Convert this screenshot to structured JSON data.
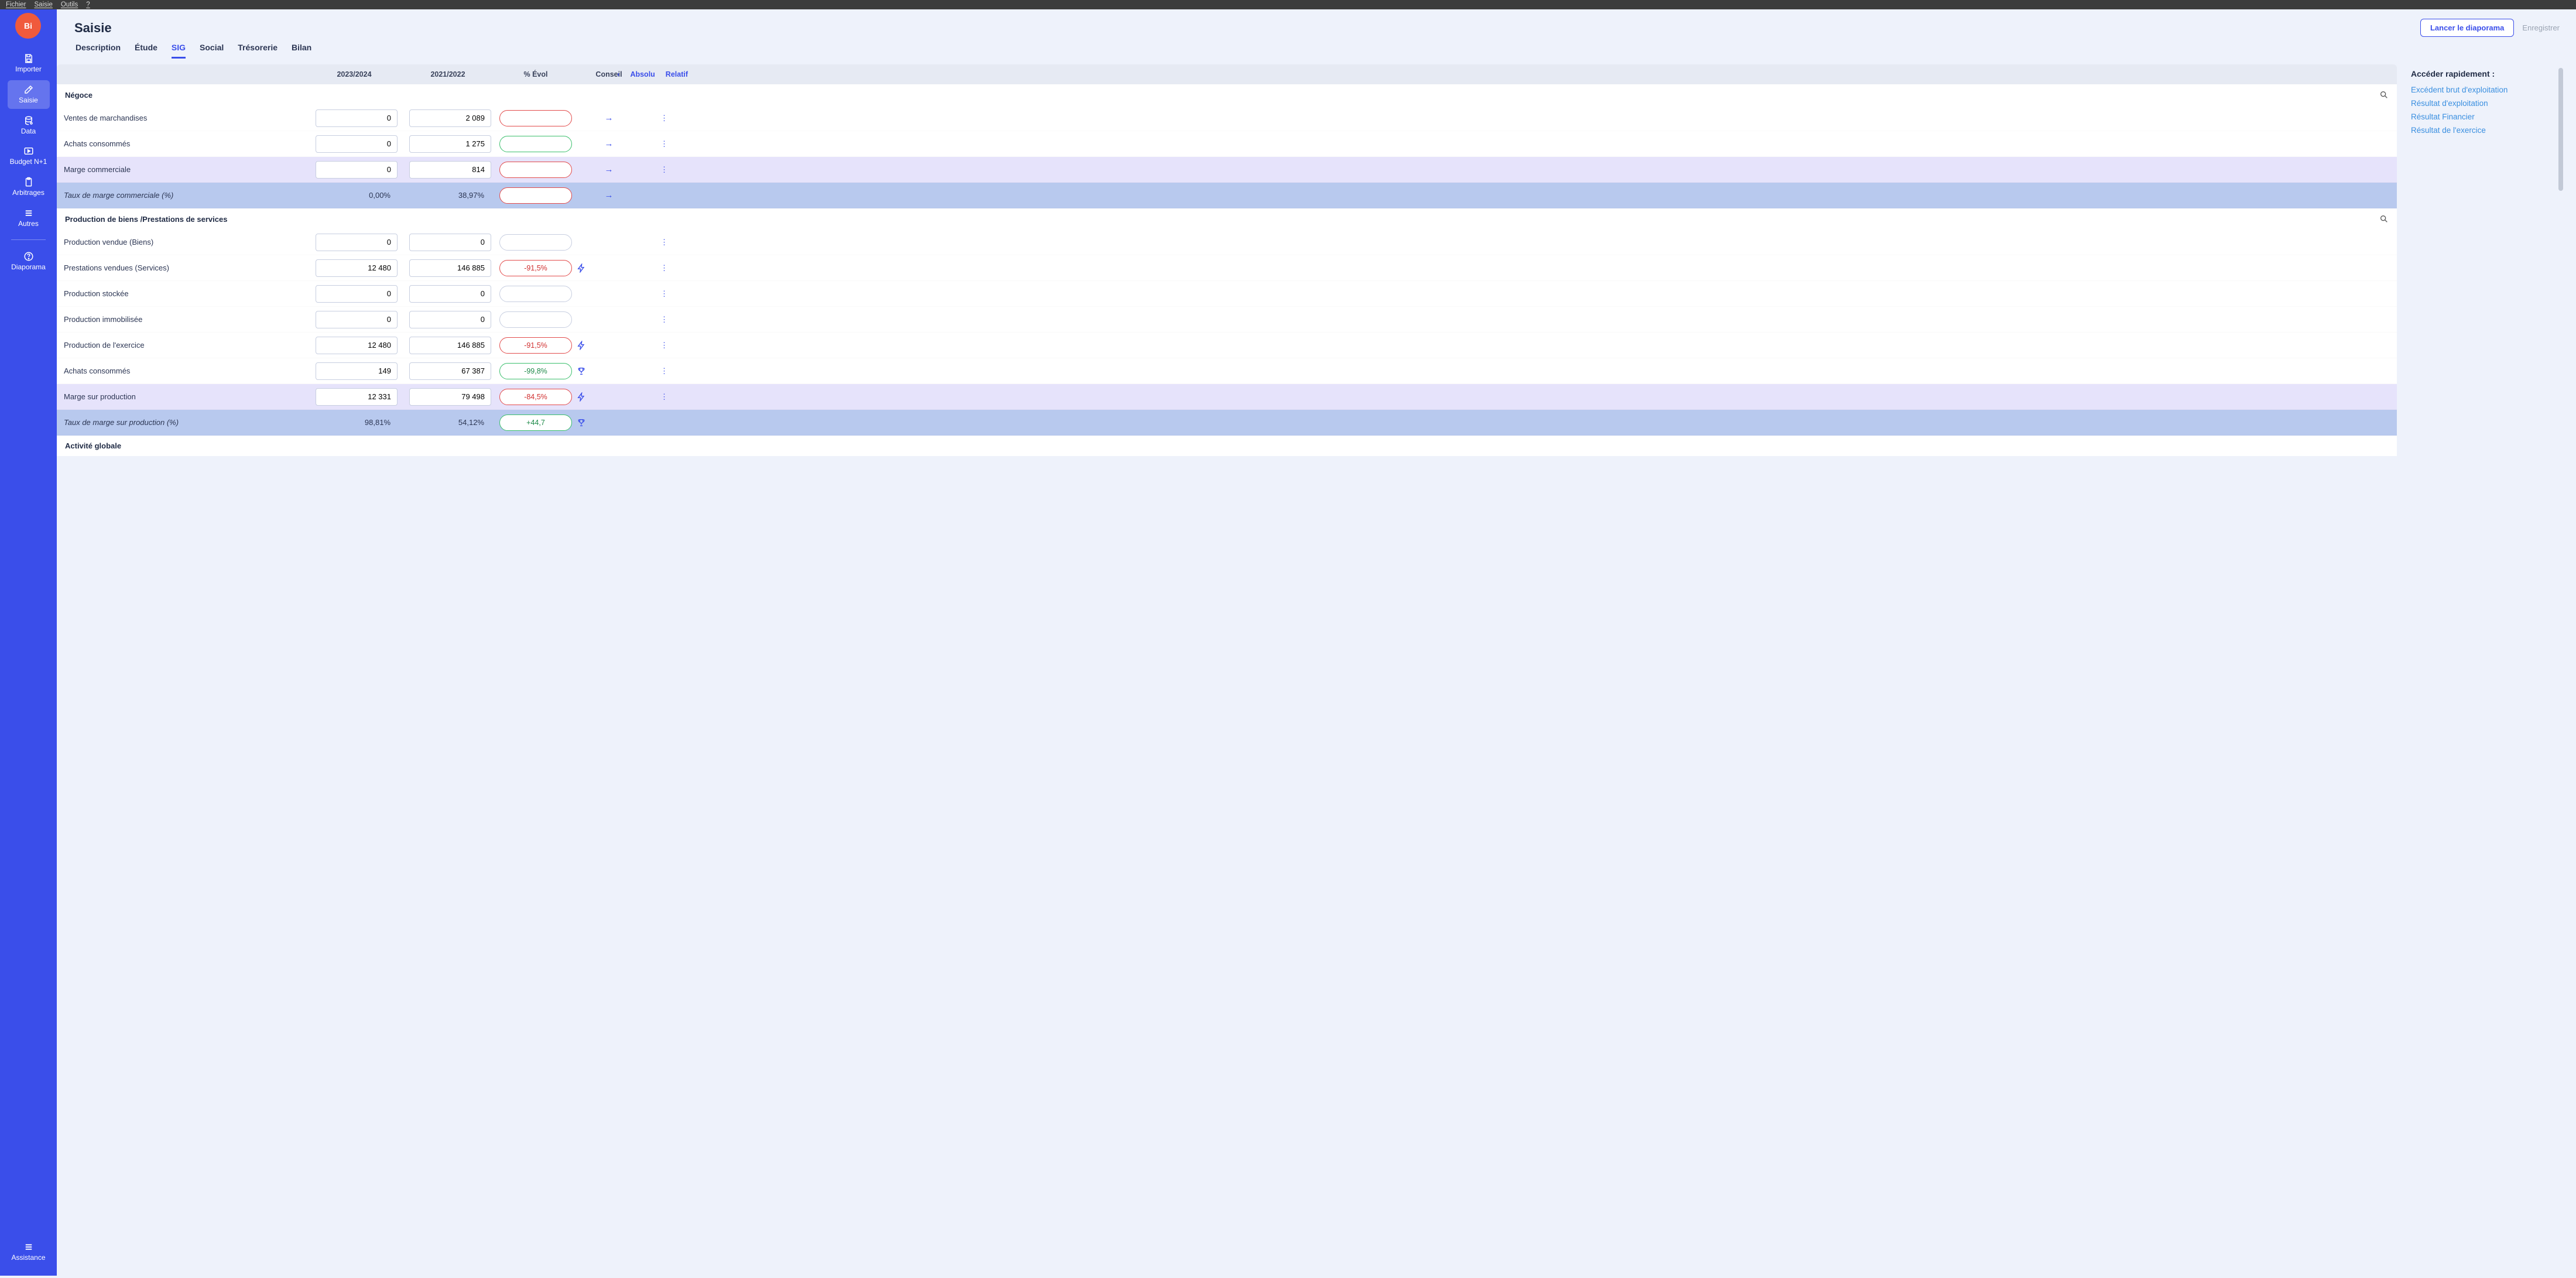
{
  "os_menu": [
    "Fichier",
    "Saisie",
    "Outils",
    "?"
  ],
  "logo_text": "Bi",
  "sidebar": {
    "items": [
      {
        "label": "Importer",
        "icon": "save-icon"
      },
      {
        "label": "Saisie",
        "icon": "edit-icon"
      },
      {
        "label": "Data",
        "icon": "data-icon"
      },
      {
        "label": "Budget N+1",
        "icon": "play-icon"
      },
      {
        "label": "Arbitrages",
        "icon": "clipboard-icon"
      },
      {
        "label": "Autres",
        "icon": "lines-icon"
      },
      {
        "label": "Diaporama",
        "icon": "help-icon"
      }
    ],
    "assistance": "Assistance"
  },
  "page_title": "Saisie",
  "actions": {
    "launch": "Lancer le diaporama",
    "save": "Enregistrer"
  },
  "tabs": [
    "Description",
    "Étude",
    "SIG",
    "Social",
    "Trésorerie",
    "Bilan"
  ],
  "active_tab_index": 2,
  "columns": {
    "c2": "2023/2024",
    "c3": "2021/2022",
    "evol": "% Évol",
    "conseil": "Conseil",
    "opt_abs": "Absolu",
    "opt_rel": "Relatif"
  },
  "sections": {
    "negoce": "Négoce",
    "prod": "Production de biens /Prestations de services",
    "activite": "Activité globale"
  },
  "rows": {
    "ventes": {
      "label": "Ventes de marchandises",
      "v1": "0",
      "v2": "2 089",
      "pill": "red",
      "evol": "",
      "conseil": "arrow"
    },
    "achats1": {
      "label": "Achats consommés",
      "v1": "0",
      "v2": "1 275",
      "pill": "green",
      "evol": "",
      "conseil": "arrow"
    },
    "marge_com": {
      "label": "Marge commerciale",
      "v1": "0",
      "v2": "814",
      "pill": "red",
      "evol": "",
      "conseil": "arrow"
    },
    "taux_marge_com": {
      "label": "Taux de marge commerciale (%)",
      "v1": "0,00%",
      "v2": "38,97%",
      "pill": "red",
      "evol": "",
      "conseil": "arrow"
    },
    "prod_vendue": {
      "label": "Production vendue (Biens)",
      "v1": "0",
      "v2": "0",
      "pill": "gray",
      "evol": "",
      "conseil": ""
    },
    "prest_vendues": {
      "label": "Prestations vendues (Services)",
      "v1": "12 480",
      "v2": "146 885",
      "pill": "red",
      "evol": "-91,5%",
      "conseil": "lightning"
    },
    "prod_stock": {
      "label": "Production stockée",
      "v1": "0",
      "v2": "0",
      "pill": "gray",
      "evol": "",
      "conseil": ""
    },
    "prod_immo": {
      "label": "Production immobilisée",
      "v1": "0",
      "v2": "0",
      "pill": "gray",
      "evol": "",
      "conseil": ""
    },
    "prod_exercice": {
      "label": "Production de l'exercice",
      "v1": "12 480",
      "v2": "146 885",
      "pill": "red",
      "evol": "-91,5%",
      "conseil": "lightning"
    },
    "achats2": {
      "label": "Achats consommés",
      "v1": "149",
      "v2": "67 387",
      "pill": "green",
      "evol": "-99,8%",
      "conseil": "trophy"
    },
    "marge_prod": {
      "label": "Marge sur production",
      "v1": "12 331",
      "v2": "79 498",
      "pill": "red",
      "evol": "-84,5%",
      "conseil": "lightning"
    },
    "taux_marge_prod": {
      "label": "Taux de marge sur production (%)",
      "v1": "98,81%",
      "v2": "54,12%",
      "pill": "green",
      "evol": "+44,7",
      "conseil": "trophy"
    }
  },
  "quick": {
    "title": "Accéder rapidement :",
    "links": [
      "Excédent brut d'exploitation",
      "Résultat d'exploitation",
      "Résultat Financier",
      "Résultat de l'exercice"
    ]
  }
}
